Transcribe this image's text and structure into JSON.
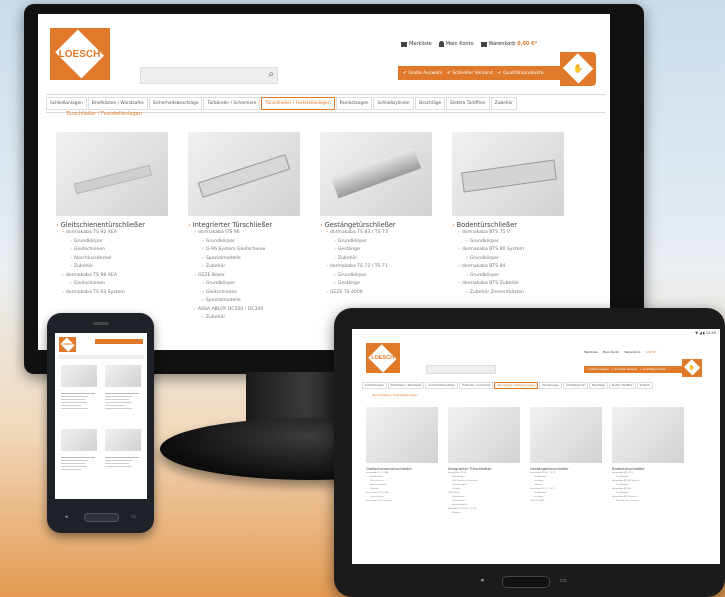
{
  "brand": {
    "logo_text": "LOESCH",
    "accent": "#e07a2a"
  },
  "header": {
    "links": [
      {
        "label": "Merkliste",
        "icon": "list-icon"
      },
      {
        "label": "Mein Konto",
        "icon": "user-icon"
      },
      {
        "label": "Warenkorb",
        "icon": "cart-icon"
      }
    ],
    "cart_amount": "0,00 €*",
    "banner_items": [
      "✔ Große Auswahl",
      "✔ Schneller Versand",
      "✔ Qualitätsprodukte"
    ]
  },
  "search": {
    "placeholder": ""
  },
  "nav": [
    "Schließanlagen",
    "Briefkästen / Wandsafes",
    "Sicherheitsbeschläge",
    "Türbänder / Scharniere",
    "Türschließer / Feststellanlagen",
    "Panikstangen",
    "Schließzylinder",
    "Beschläge",
    "Elektro Türöffner",
    "Zubehör"
  ],
  "breadcrumb": "Türschließer / Feststellanlagen",
  "categories": [
    {
      "title": "Gleitschienentürschließer",
      "lines": [
        {
          "text": "dormakaba TS 92 XEA",
          "level": 1
        },
        {
          "text": "Grundkörper",
          "level": 2
        },
        {
          "text": "Gleitschienen",
          "level": 2
        },
        {
          "text": "Abschlussdeckel",
          "level": 2
        },
        {
          "text": "Zubehör",
          "level": 2
        },
        {
          "text": "dormakaba TS 98 XEA",
          "level": 1
        },
        {
          "text": "Gleitschienen",
          "level": 2
        },
        {
          "text": "dormakaba TS 93 System",
          "level": 1
        }
      ]
    },
    {
      "title": "Integrierter Türschließer",
      "lines": [
        {
          "text": "dormakaba ITS 96",
          "level": 1
        },
        {
          "text": "Grundkörper",
          "level": 2
        },
        {
          "text": "G-96 System Gleitschiene",
          "level": 2
        },
        {
          "text": "Spezialmodelle",
          "level": 2
        },
        {
          "text": "Zubehör",
          "level": 2
        },
        {
          "text": "GEZE Boxer",
          "level": 1
        },
        {
          "text": "Grundkörper",
          "level": 2
        },
        {
          "text": "Gleitschienen",
          "level": 2
        },
        {
          "text": "Spezialmodelle",
          "level": 2
        },
        {
          "text": "ASSA ABLOY DC500 / DC300",
          "level": 1
        },
        {
          "text": "Zubehör",
          "level": 2
        }
      ]
    },
    {
      "title": "Gestängetürschließer",
      "lines": [
        {
          "text": "dormakaba TS 83 / TS 73",
          "level": 1
        },
        {
          "text": "Grundkörper",
          "level": 2
        },
        {
          "text": "Gestänge",
          "level": 2
        },
        {
          "text": "Zubehör",
          "level": 2
        },
        {
          "text": "dormakaba TS 72 / TS 71",
          "level": 1
        },
        {
          "text": "Grundkörper",
          "level": 2
        },
        {
          "text": "Gestänge",
          "level": 2
        },
        {
          "text": "GEZE TS 4000",
          "level": 1
        }
      ]
    },
    {
      "title": "Bodentürschließer",
      "lines": [
        {
          "text": "dormakaba BTS 75 V",
          "level": 1
        },
        {
          "text": "Grundkörper",
          "level": 2
        },
        {
          "text": "dormakaba BTS 80 System",
          "level": 1
        },
        {
          "text": "Grundkörper",
          "level": 2
        },
        {
          "text": "dormakaba BTS 84",
          "level": 1
        },
        {
          "text": "Grundkörper",
          "level": 2
        },
        {
          "text": "dormakaba BTS Zubehör",
          "level": 1
        },
        {
          "text": "Zubehör Zementkästen",
          "level": 2
        }
      ]
    }
  ],
  "tablet": {
    "status": "▼ ◢ ▮ 12:45"
  }
}
